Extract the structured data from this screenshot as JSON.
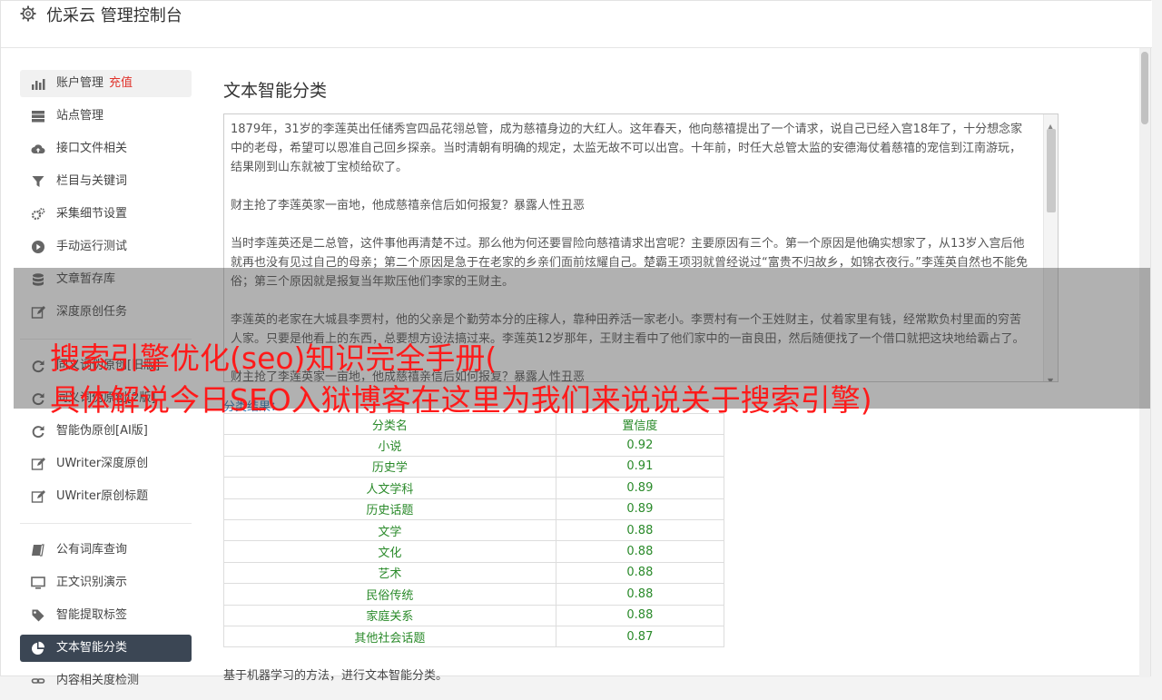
{
  "header": {
    "title": "优采云 管理控制台"
  },
  "sidebar": {
    "items": [
      {
        "label": "账户管理",
        "extra": "充值"
      },
      {
        "label": "站点管理"
      },
      {
        "label": "接口文件相关"
      },
      {
        "label": "栏目与关键词"
      },
      {
        "label": "采集细节设置"
      },
      {
        "label": "手动运行测试"
      },
      {
        "label": "文章暂存库"
      },
      {
        "label": "深度原创任务"
      },
      {
        "label": "同义词伪原创[旧版]"
      },
      {
        "label": "同义词伪原创[2版]"
      },
      {
        "label": "智能伪原创[AI版]"
      },
      {
        "label": "UWriter深度原创"
      },
      {
        "label": "UWriter原创标题"
      },
      {
        "label": "公有词库查询"
      },
      {
        "label": "正文识别演示"
      },
      {
        "label": "智能提取标签"
      },
      {
        "label": "文本智能分类"
      },
      {
        "label": "内容相关度检测"
      }
    ]
  },
  "main": {
    "title": "文本智能分类",
    "text_paragraphs": [
      "1879年，31岁的李莲英出任储秀宫四品花翎总管，成为慈禧身边的大红人。这年春天，他向慈禧提出了一个请求，说自己已经入宫18年了，十分想念家中的老母，希望可以恩准自己回乡探亲。当时清朝有明确的规定，太监无故不可以出宫。十年前，时任大总管太监的安德海仗着慈禧的宠信到江南游玩，结果刚到山东就被丁宝桢给砍了。",
      "财主抢了李莲英家一亩地，他成慈禧亲信后如何报复？暴露人性丑恶",
      "当时李莲英还是二总管，这件事他再清楚不过。那么他为何还要冒险向慈禧请求出宫呢？主要原因有三个。第一个原因是他确实想家了，从13岁入宫后他就再也没有见过自己的母亲；第二个原因是急于在老家的乡亲们面前炫耀自己。楚霸王项羽就曾经说过“富贵不归故乡，如锦衣夜行。”李莲英自然也不能免俗；第三个原因就是报复当年欺压他们李家的王财主。",
      "李莲英的老家在大城县李贾村，他的父亲是个勤劳本分的庄稼人，靠种田养活一家老小。李贾村有一个王姓财主，仗着家里有钱，经常欺负村里面的穷苦人家。只要是他看上的东西，总要想方设法搞过来。李莲英12岁那年，王财主看中了他们家中的一亩良田，然后随便找了一个借口就把这块地给霸占了。",
      "财主抢了李莲英家一亩地，他成慈禧亲信后如何报复？暴露人性丑恶"
    ],
    "result_label": "分类结果：",
    "table_headers": [
      "分类名",
      "置信度"
    ],
    "table_rows": [
      [
        "小说",
        "0.92"
      ],
      [
        "历史学",
        "0.91"
      ],
      [
        "人文学科",
        "0.89"
      ],
      [
        "历史话题",
        "0.89"
      ],
      [
        "文学",
        "0.88"
      ],
      [
        "文化",
        "0.88"
      ],
      [
        "艺术",
        "0.88"
      ],
      [
        "民俗传统",
        "0.88"
      ],
      [
        "家庭关系",
        "0.88"
      ],
      [
        "其他社会话题",
        "0.87"
      ]
    ],
    "description": "基于机器学习的方法，进行文本智能分类。"
  },
  "overlay": {
    "line1": "搜索引擎优化(seo)知识完全手册(",
    "line2": "具体解说今日SEO入狱博客在这里为我们来说说关于搜索引擎)"
  },
  "colors": {
    "accent": "#3b4654",
    "recharge": "#e0332c",
    "headline": "#ff1a1a",
    "result_text": "#2a8a2a"
  },
  "icons": [
    "gear-icon",
    "bar-chart-icon",
    "server-icon",
    "cloud-upload-icon",
    "filter-icon",
    "cogs-icon",
    "play-circle-icon",
    "database-icon",
    "edit-icon",
    "refresh-icon",
    "refresh-icon",
    "refresh-icon",
    "edit-icon",
    "edit-icon",
    "book-icon",
    "monitor-icon",
    "tag-icon",
    "pie-chart-icon",
    "link-icon"
  ]
}
